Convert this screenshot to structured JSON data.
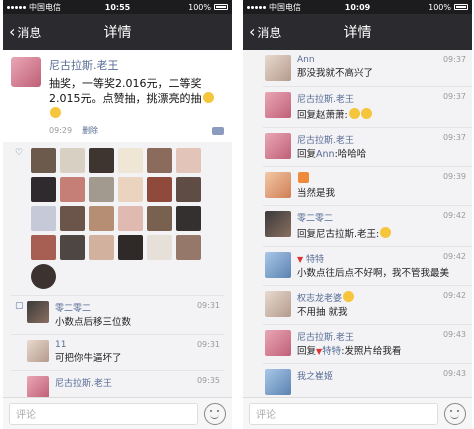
{
  "left": {
    "status": {
      "carrier": "中国电信",
      "time": "10:55",
      "battery": "100%"
    },
    "nav": {
      "back": "消息",
      "title": "详情"
    },
    "post": {
      "author": "尼古拉斯.老王",
      "text": "抽奖，一等奖2.016元，二等奖2.015元。点赞抽，挑漂亮的抽",
      "time": "09:29",
      "delete": "删除"
    },
    "comments": [
      {
        "name": "零二零二",
        "text": "小数点后移三位数",
        "time": "09:31"
      },
      {
        "name": "11",
        "text": "可把你牛逼坏了",
        "time": "09:31"
      },
      {
        "name": "尼古拉斯.老王",
        "text": "",
        "time": "09:35"
      }
    ],
    "input_placeholder": "评论"
  },
  "right": {
    "status": {
      "carrier": "中国电信",
      "time": "10:09",
      "battery": "100%"
    },
    "nav": {
      "back": "消息",
      "title": "详情"
    },
    "comments": [
      {
        "name": "Ann",
        "text": "那没我就不高兴了",
        "time": "09:37"
      },
      {
        "name": "尼古拉斯.老王",
        "text": "回复赵萧萧:",
        "time": "09:37"
      },
      {
        "name": "尼古拉斯.老王",
        "text_prefix": "回复",
        "reply_to": "Ann",
        "text": ":哈哈哈",
        "time": "09:37"
      },
      {
        "name": "",
        "text": "当然是我",
        "time": "09:39"
      },
      {
        "name": "零二零二",
        "text": "回复尼古拉斯.老王:",
        "time": "09:42"
      },
      {
        "name": "特特",
        "text": "小数点往后点不好啊，我不管我最美",
        "time": "09:42"
      },
      {
        "name": "权志龙老婆",
        "text": "不用抽 就我",
        "time": "09:42"
      },
      {
        "name": "尼古拉斯.老王",
        "text_prefix": "回复",
        "reply_to": "特特",
        "text": ":发照片给我看",
        "time": "09:43"
      },
      {
        "name": "我之崔姬",
        "text": "",
        "time": "09:43"
      }
    ],
    "input_placeholder": "评论"
  }
}
